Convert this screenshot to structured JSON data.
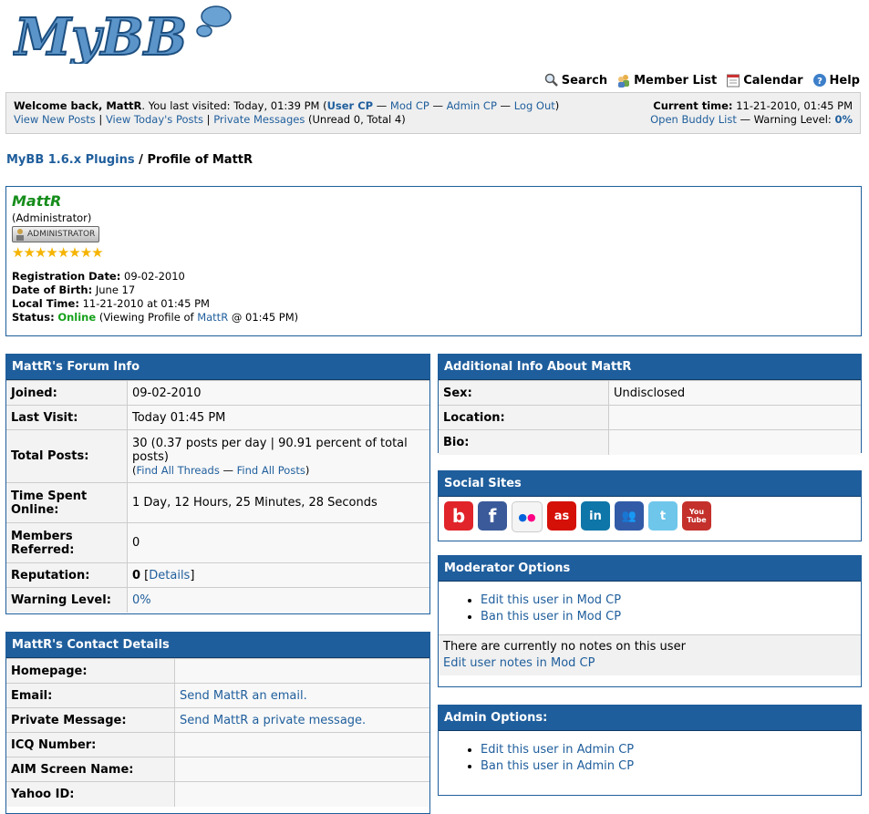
{
  "logo_text": "MyBB",
  "nav": {
    "search": "Search",
    "member_list": "Member List",
    "calendar": "Calendar",
    "help": "Help"
  },
  "welcome": {
    "prefix": "Welcome back, ",
    "user": "MattR",
    "last_visited": ". You last visited: Today, 01:39 PM (",
    "user_cp": "User CP",
    "mod_cp": "Mod CP",
    "admin_cp": "Admin CP",
    "logout": "Log Out",
    "view_new_posts": "View New Posts",
    "view_todays_posts": "View Today's Posts",
    "private_messages": "Private Messages",
    "pm_counts": "(Unread 0, Total 4)",
    "current_time_label": "Current time:",
    "current_time": "11-21-2010, 01:45 PM",
    "buddy_list": "Open Buddy List",
    "warning_label": "— Warning Level:",
    "warning_value": "0%"
  },
  "breadcrumb": {
    "forum": "MyBB 1.6.x Plugins",
    "sep": "/",
    "current": "Profile of MattR"
  },
  "profile": {
    "username": "MattR",
    "usertitle": "(Administrator)",
    "badge": "ADMINISTRATOR",
    "stars": 8,
    "reg_label": "Registration Date:",
    "reg_value": "09-02-2010",
    "dob_label": "Date of Birth:",
    "dob_value": "June 17",
    "local_label": "Local Time:",
    "local_value": "11-21-2010 at 01:45 PM",
    "status_label": "Status:",
    "status_value": "Online",
    "status_detail_pre": "(Viewing Profile of ",
    "status_detail_link": "MattR",
    "status_detail_post": " @ 01:45 PM)"
  },
  "forum_info": {
    "title": "MattR's Forum Info",
    "joined_label": "Joined:",
    "joined": "09-02-2010",
    "last_visit_label": "Last Visit:",
    "last_visit": "Today 01:45 PM",
    "total_posts_label": "Total Posts:",
    "total_posts": "30 (0.37 posts per day | 90.91 percent of total posts)",
    "find_threads": "Find All Threads",
    "find_posts": "Find All Posts",
    "time_online_label": "Time Spent Online:",
    "time_online": "1 Day, 12 Hours, 25 Minutes, 28 Seconds",
    "referred_label": "Members Referred:",
    "referred": "0",
    "reputation_label": "Reputation:",
    "reputation": "0",
    "reputation_details": "Details",
    "warning_label": "Warning Level:",
    "warning": "0%"
  },
  "contact": {
    "title": "MattR's Contact Details",
    "homepage_label": "Homepage:",
    "email_label": "Email:",
    "email_link": "Send MattR an email.",
    "pm_label": "Private Message:",
    "pm_link": "Send MattR a private message.",
    "icq_label": "ICQ Number:",
    "aim_label": "AIM Screen Name:",
    "yahoo_label": "Yahoo ID:"
  },
  "additional": {
    "title": "Additional Info About MattR",
    "sex_label": "Sex:",
    "sex": "Undisclosed",
    "location_label": "Location:",
    "bio_label": "Bio:"
  },
  "social": {
    "title": "Social Sites",
    "sites": [
      {
        "name": "bebo",
        "glyph": "b",
        "color": "#e0242a"
      },
      {
        "name": "facebook",
        "glyph": "f",
        "color": "#3b5a9a"
      },
      {
        "name": "flickr",
        "glyph": "●●",
        "color": "#f4f4f4"
      },
      {
        "name": "lastfm",
        "glyph": "as",
        "color": "#d51007"
      },
      {
        "name": "linkedin",
        "glyph": "in",
        "color": "#0e76a8"
      },
      {
        "name": "myspace",
        "glyph": "👥",
        "color": "#315ba7"
      },
      {
        "name": "twitter",
        "glyph": "t",
        "color": "#6ec6ea"
      },
      {
        "name": "youtube",
        "glyph": "You Tube",
        "color": "#c4302b"
      }
    ]
  },
  "moderator": {
    "title": "Moderator Options",
    "edit": "Edit this user in Mod CP",
    "ban": "Ban this user in Mod CP",
    "no_notes": "There are currently no notes on this user",
    "edit_notes": "Edit user notes in Mod CP"
  },
  "admin": {
    "title": "Admin Options:",
    "edit": "Edit this user in Admin CP",
    "ban": "Ban this user in Admin CP"
  }
}
